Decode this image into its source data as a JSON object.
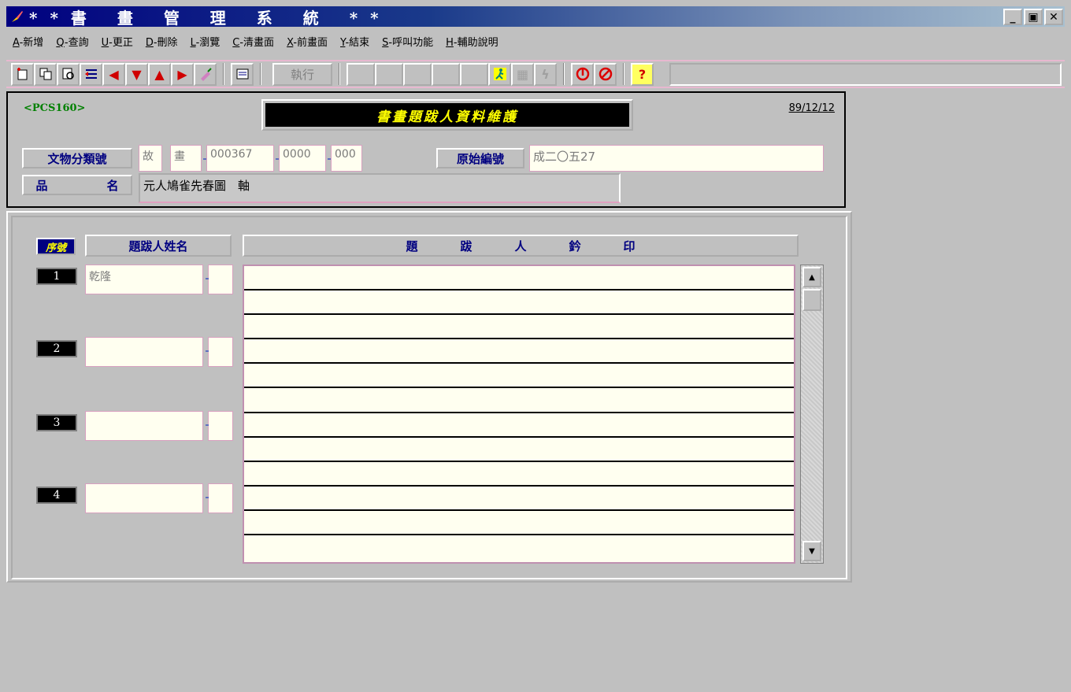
{
  "window": {
    "title": "**書 畫 管 理 系 統 **",
    "buttons": [
      "_",
      "▣",
      "✕"
    ]
  },
  "menu": [
    {
      "key": "A",
      "label": "-新增"
    },
    {
      "key": "Q",
      "label": "-查詢"
    },
    {
      "key": "U",
      "label": "-更正"
    },
    {
      "key": "D",
      "label": "-刪除"
    },
    {
      "key": "L",
      "label": "-瀏覽"
    },
    {
      "key": "C",
      "label": "-清畫面"
    },
    {
      "key": "X",
      "label": "-前畫面"
    },
    {
      "key": "Y",
      "label": "-結束"
    },
    {
      "key": "S",
      "label": "-呼叫功能"
    },
    {
      "key": "H",
      "label": "-輔助說明"
    }
  ],
  "toolbar": {
    "execute_label": "執行",
    "icons": [
      "add-record-icon",
      "copy-record-icon",
      "query-icon",
      "list-icon",
      "first-record-icon",
      "next-record-icon",
      "previous-record-icon",
      "last-record-icon",
      "clear-icon",
      "print-icon",
      "run-icon",
      "disabled-tool-icon",
      "disabled-tool-icon",
      "stop-icon",
      "cancel-icon",
      "help-icon"
    ]
  },
  "header": {
    "program_code": "<PCS160>",
    "date": "89/12/12",
    "form_title": "書畫題跋人資料維護",
    "classification_label": "文物分類號",
    "classification": [
      "故",
      "畫",
      "000367",
      "0000",
      "000"
    ],
    "original_no_label": "原始編號",
    "original_no": "成二〇五27",
    "item_name_label": "品　名",
    "item_name": "元人鳩雀先春圖　軸"
  },
  "detail": {
    "seq_header": "序號",
    "name_header": "題跋人姓名",
    "seal_header": "題跋人鈐印",
    "rows": [
      {
        "num": "1",
        "name": "乾隆"
      },
      {
        "num": "2",
        "name": ""
      },
      {
        "num": "3",
        "name": ""
      },
      {
        "num": "4",
        "name": ""
      }
    ],
    "seal_rows": 12
  }
}
